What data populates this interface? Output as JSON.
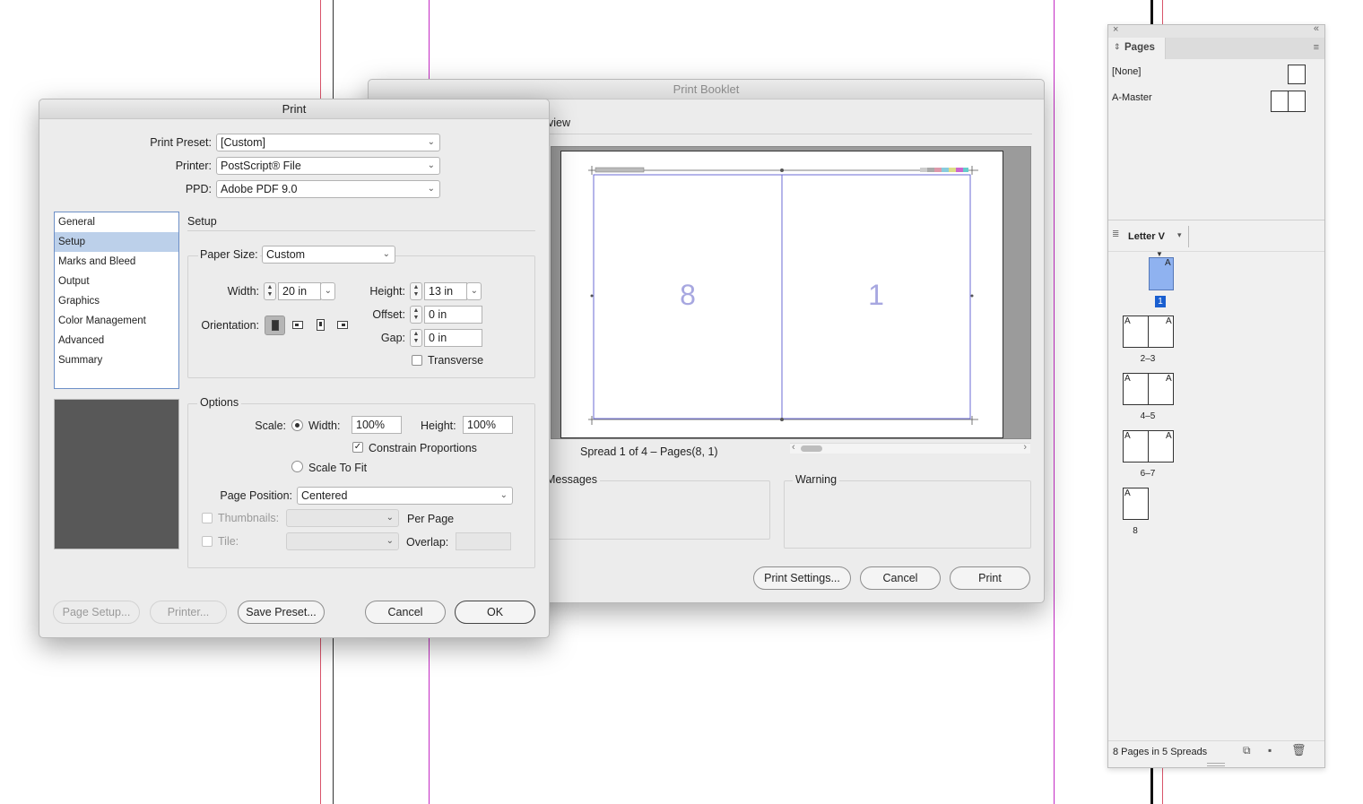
{
  "print_dialog": {
    "title": "Print",
    "print_preset_label": "Print Preset:",
    "print_preset_value": "[Custom]",
    "printer_label": "Printer:",
    "printer_value": "PostScript® File",
    "ppd_label": "PPD:",
    "ppd_value": "Adobe PDF 9.0",
    "nav_items": [
      "General",
      "Setup",
      "Marks and Bleed",
      "Output",
      "Graphics",
      "Color Management",
      "Advanced",
      "Summary"
    ],
    "selected_nav": "Setup",
    "setup_heading": "Setup",
    "paper_size_label": "Paper Size:",
    "paper_size_value": "Custom",
    "width_label": "Width:",
    "width_value": "20 in",
    "height_label": "Height:",
    "height_value": "13 in",
    "offset_label": "Offset:",
    "offset_value": "0 in",
    "gap_label": "Gap:",
    "gap_value": "0 in",
    "orientation_label": "Orientation:",
    "transverse_label": "Transverse",
    "options_heading": "Options",
    "scale_label": "Scale:",
    "scale_width_label": "Width:",
    "scale_width_value": "100%",
    "scale_height_label": "Height:",
    "scale_height_value": "100%",
    "constrain_label": "Constrain Proportions",
    "scale_to_fit_label": "Scale To Fit",
    "page_position_label": "Page Position:",
    "page_position_value": "Centered",
    "thumbnails_label": "Thumbnails:",
    "per_page_label": "Per Page",
    "tile_label": "Tile:",
    "overlap_label": "Overlap:",
    "btn_page_setup": "Page Setup...",
    "btn_printer": "Printer...",
    "btn_save_preset": "Save Preset...",
    "btn_cancel": "Cancel",
    "btn_ok": "OK"
  },
  "booklet_dialog": {
    "title": "Print Booklet",
    "tab_preview": "view",
    "left_page_number": "8",
    "right_page_number": "1",
    "spread_info": "Spread 1 of 4 – Pages(8, 1)",
    "messages_label": "Messages",
    "warning_label": "Warning",
    "btn_print_settings": "Print Settings...",
    "btn_cancel": "Cancel",
    "btn_print": "Print"
  },
  "pages_panel": {
    "tab_label": "Pages",
    "none_label": "[None]",
    "master_label": "A-Master",
    "size_label": "Letter V",
    "first_page_number": "1",
    "master_prefix": "A",
    "spread_labels": [
      "2–3",
      "4–5",
      "6–7",
      "8"
    ],
    "footer_text": "8 Pages in 5 Spreads"
  },
  "colors": {
    "selection_blue": "#bcd0ea",
    "guide_magenta": "#c42bc4",
    "guide_red": "#d9546a",
    "page_thumb_blue": "#8fb2f0",
    "preview_line": "#6b6bd6"
  }
}
